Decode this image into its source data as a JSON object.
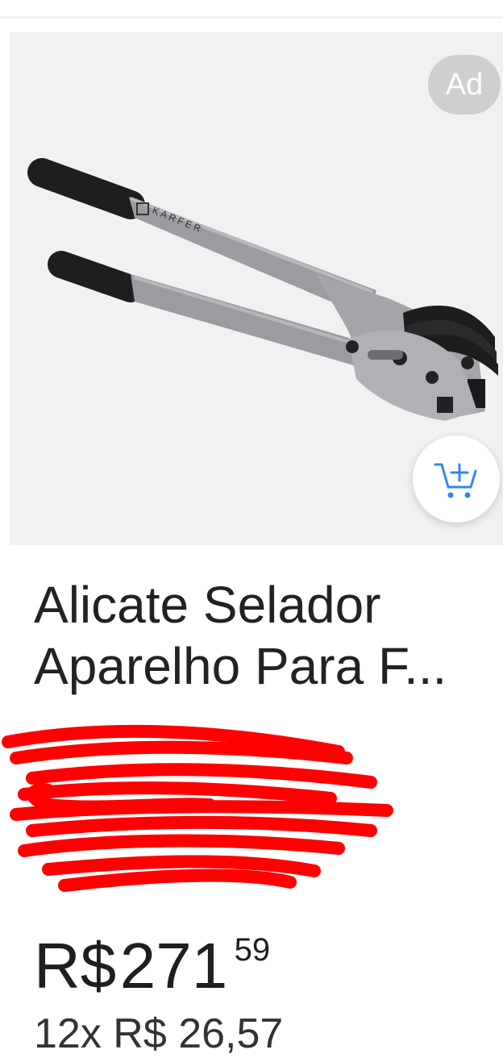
{
  "ad_badge": "Ad",
  "product": {
    "title_lines": [
      "Alicate Selador",
      "Aparelho Para F..."
    ],
    "image_brand_text": "KARFER",
    "price": {
      "currency": "R$",
      "integer": "271",
      "cents": "59"
    },
    "installments": "12x R$ 26,57"
  },
  "icons": {
    "add_to_cart": "cart-plus-icon"
  },
  "colors": {
    "accent": "#3483fa",
    "redaction": "#ff0000",
    "image_background": "#f1f1f1"
  }
}
